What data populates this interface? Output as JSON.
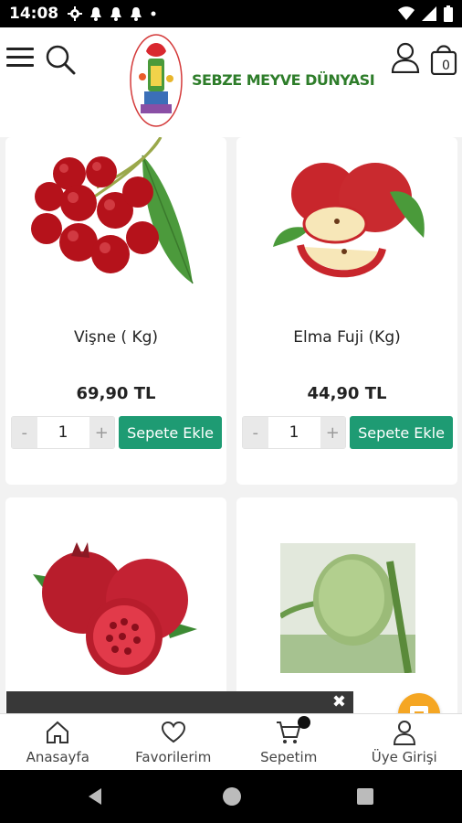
{
  "status_bar": {
    "time": "14:08",
    "icons": [
      "gear-icon",
      "bell-icon",
      "bell-icon",
      "bell-icon",
      "dot-icon"
    ],
    "right_icons": [
      "wifi-icon",
      "signal-icon",
      "battery-icon"
    ]
  },
  "header": {
    "logo_text": "SEBZE MEYVE DÜNYASI",
    "bag_count": "0"
  },
  "products": [
    {
      "name": "Vişne ( Kg)",
      "price": "69,90 TL",
      "qty": "1",
      "add_label": "Sepete Ekle",
      "minus": "-",
      "plus": "+"
    },
    {
      "name": "Elma Fuji (Kg)",
      "price": "44,90 TL",
      "qty": "1",
      "add_label": "Sepete Ekle",
      "minus": "-",
      "plus": "+"
    },
    {
      "name": "",
      "price": "",
      "qty": "",
      "add_label": ""
    },
    {
      "name": "",
      "price": "",
      "qty": "",
      "add_label": ""
    }
  ],
  "toast": {
    "close_label": "✖"
  },
  "bottom_nav": [
    {
      "label": "Anasayfa",
      "icon": "home-icon"
    },
    {
      "label": "Favorilerim",
      "icon": "heart-icon"
    },
    {
      "label": "Sepetim",
      "icon": "cart-icon"
    },
    {
      "label": "Üye Girişi",
      "icon": "user-icon"
    }
  ],
  "colors": {
    "accent": "#1e9b73",
    "logo_green": "#2e7d2a",
    "chat_fab": "#f5a623"
  }
}
